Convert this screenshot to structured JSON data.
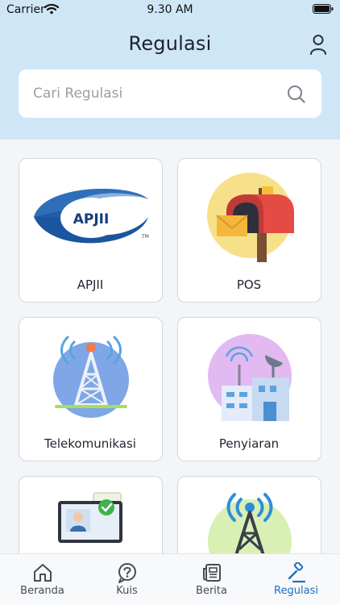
{
  "status_bar": {
    "carrier": "Carrier",
    "time": "9.30 AM"
  },
  "header": {
    "title": "Regulasi"
  },
  "search": {
    "placeholder": "Cari Regulasi"
  },
  "cards": [
    {
      "label": "APJII",
      "logo_text": "APJII",
      "logo_mark": "TM",
      "icon": "apjii-logo"
    },
    {
      "label": "POS",
      "icon": "mailbox-icon"
    },
    {
      "label": "Telekomunikasi",
      "icon": "transmission-tower-icon"
    },
    {
      "label": "Penyiaran",
      "icon": "broadcast-building-icon"
    },
    {
      "label": "",
      "icon": "computer-verified-icon"
    },
    {
      "label": "",
      "icon": "signal-tower-icon"
    }
  ],
  "bottom_nav": [
    {
      "label": "Beranda",
      "icon": "home-icon"
    },
    {
      "label": "Kuis",
      "icon": "question-circle-icon"
    },
    {
      "label": "Berita",
      "icon": "newspaper-icon"
    },
    {
      "label": "Regulasi",
      "icon": "gavel-icon",
      "active": true
    }
  ],
  "colors": {
    "header_bg": "#cfe6f7",
    "accent": "#1f6fc2",
    "page_bg": "#f3f5f8"
  }
}
